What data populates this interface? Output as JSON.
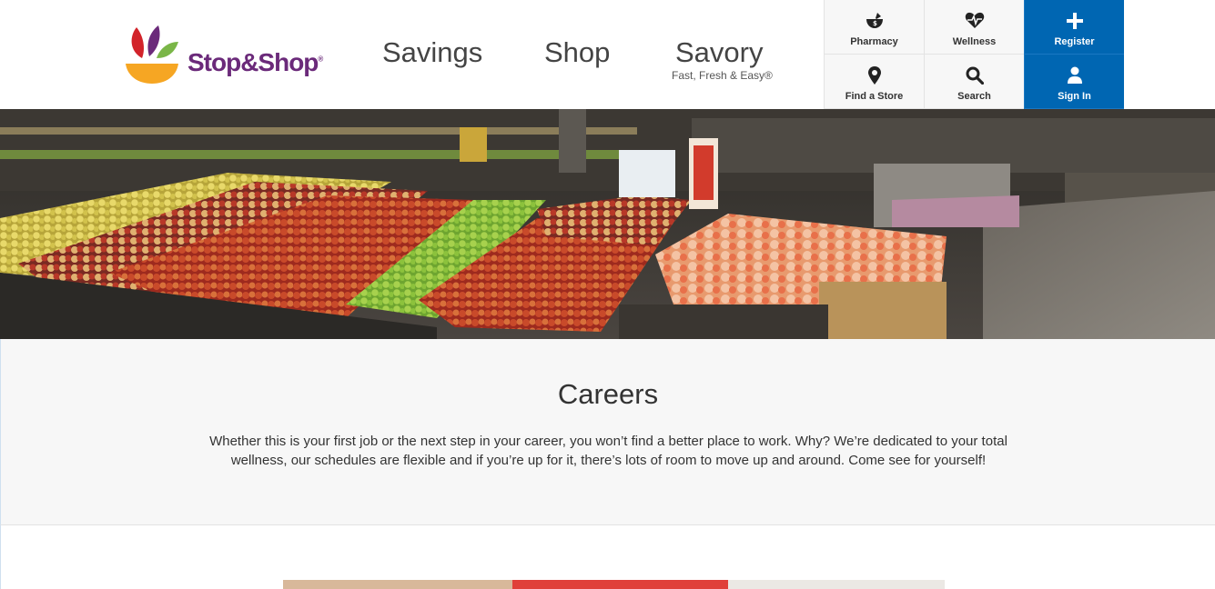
{
  "brand": {
    "name": "Stop&Shop",
    "registered": "®"
  },
  "nav": {
    "savings": "Savings",
    "shop": "Shop",
    "savory": "Savory",
    "savory_tagline": "Fast, Fresh & Easy®"
  },
  "utility": {
    "pharmacy": {
      "label": "Pharmacy",
      "icon": "mortar-pestle-icon"
    },
    "wellness": {
      "label": "Wellness",
      "icon": "heartbeat-icon"
    },
    "register": {
      "label": "Register",
      "icon": "plus-icon"
    },
    "find_store": {
      "label": "Find a Store",
      "icon": "map-pin-icon"
    },
    "search": {
      "label": "Search",
      "icon": "search-icon"
    },
    "sign_in": {
      "label": "Sign In",
      "icon": "user-icon"
    }
  },
  "colors": {
    "accent_blue": "#0066b2",
    "brand_purple": "#6b2a7a",
    "logo_red": "#d2232a",
    "logo_green": "#7ab648",
    "logo_yellow": "#f6a623"
  },
  "careers": {
    "title": "Careers",
    "body": "Whether this is your first job or the next step in your career, you won’t find a better place to work. Why? We’re dedicated to your total wellness, our schedules are flexible and if you’re up for it, there’s lots of room to move up and around. Come see for yourself!"
  }
}
